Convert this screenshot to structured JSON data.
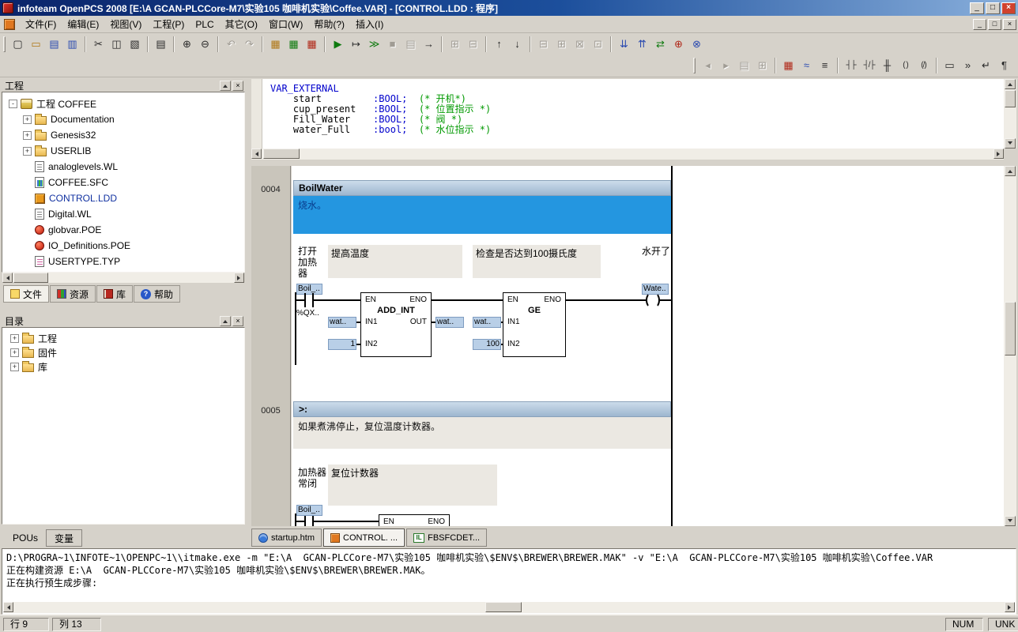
{
  "titlebar": {
    "title": "infoteam OpenPCS 2008 [E:\\A  GCAN-PLCCore-M7\\实验105 咖啡机实验\\Coffee.VAR]  - [CONTROL.LDD : 程序]",
    "minimize": "_",
    "maximize": "□",
    "close": "×"
  },
  "menubar": {
    "items": [
      "文件(F)",
      "编辑(E)",
      "视图(V)",
      "工程(P)",
      "PLC",
      "其它(O)",
      "窗口(W)",
      "帮助(?)",
      "插入(I)"
    ],
    "child_min": "_",
    "child_restore": "□",
    "child_close": "×"
  },
  "toolbar_main": {
    "icons": [
      {
        "name": "new-file-icon",
        "glyph": "▢"
      },
      {
        "name": "open-folder-icon",
        "glyph": "▭"
      },
      {
        "name": "save-icon",
        "glyph": "▤"
      },
      {
        "name": "save-all-icon",
        "glyph": "▥"
      },
      {
        "name": "cut-icon",
        "glyph": "✂"
      },
      {
        "name": "copy-icon",
        "glyph": "◫"
      },
      {
        "name": "paste-icon",
        "glyph": "▧"
      },
      {
        "name": "print-icon",
        "glyph": "▤"
      },
      {
        "name": "zoom-in-icon",
        "glyph": "⊕"
      },
      {
        "name": "zoom-out-icon",
        "glyph": "⊖"
      },
      {
        "name": "undo-icon",
        "glyph": "↶"
      },
      {
        "name": "redo-icon",
        "glyph": "↷"
      },
      {
        "name": "build-icon",
        "glyph": "▦"
      },
      {
        "name": "make-all-icon",
        "glyph": "▦"
      },
      {
        "name": "rebuild-icon",
        "glyph": "▦"
      },
      {
        "name": "run-icon",
        "glyph": "▶"
      },
      {
        "name": "step-icon",
        "glyph": "↦"
      },
      {
        "name": "continue-icon",
        "glyph": "≫"
      },
      {
        "name": "stop-icon",
        "glyph": "■"
      },
      {
        "name": "call-stack-icon",
        "glyph": "▤"
      },
      {
        "name": "goto-icon",
        "glyph": "→"
      },
      {
        "name": "watch-list-icon",
        "glyph": "⊞"
      },
      {
        "name": "cross-reference-icon",
        "glyph": "⊟"
      },
      {
        "name": "move-up-icon",
        "glyph": "↑"
      },
      {
        "name": "move-down-icon",
        "glyph": "↓"
      },
      {
        "name": "window-layout-1-icon",
        "glyph": "⊟"
      },
      {
        "name": "window-layout-2-icon",
        "glyph": "⊞"
      },
      {
        "name": "window-layout-3-icon",
        "glyph": "⊠"
      },
      {
        "name": "window-layout-4-icon",
        "glyph": "⊡"
      },
      {
        "name": "download-icon",
        "glyph": "⇊"
      },
      {
        "name": "upload-icon",
        "glyph": "⇈"
      },
      {
        "name": "compare-icon",
        "glyph": "⇄"
      },
      {
        "name": "online-icon",
        "glyph": "⊕"
      },
      {
        "name": "offline-icon",
        "glyph": "⊗"
      }
    ]
  },
  "toolbar_ladder": {
    "icons": [
      {
        "name": "back-icon",
        "glyph": "◂"
      },
      {
        "name": "forward-icon",
        "glyph": "▸"
      },
      {
        "name": "page-overview-icon",
        "glyph": "▤"
      },
      {
        "name": "watch-window-icon",
        "glyph": "⊞"
      },
      {
        "name": "io-editor-icon",
        "glyph": "▦"
      },
      {
        "name": "trace-icon",
        "glyph": "≈"
      },
      {
        "name": "network-list-icon",
        "glyph": "≡"
      },
      {
        "name": "insert-contact-icon",
        "glyph": "┤├"
      },
      {
        "name": "insert-negated-contact-icon",
        "glyph": "┤/├"
      },
      {
        "name": "insert-parallel-contact-icon",
        "glyph": "╫"
      },
      {
        "name": "insert-coil-icon",
        "glyph": "( )"
      },
      {
        "name": "insert-negated-coil-icon",
        "gl yph": "(/)",
        "glyph": "(/)"
      },
      {
        "name": "insert-function-block-icon",
        "glyph": "▭"
      },
      {
        "name": "insert-jump-icon",
        "glyph": "»"
      },
      {
        "name": "insert-return-icon",
        "glyph": "↵"
      },
      {
        "name": "insert-label-icon",
        "glyph": "¶"
      }
    ]
  },
  "project_panel": {
    "title": "工程",
    "close": "×",
    "root": {
      "label": "工程 COFFEE",
      "expander": "-"
    },
    "items": [
      {
        "label": "Documentation",
        "expander": "+"
      },
      {
        "label": "Genesis32",
        "expander": "+"
      },
      {
        "label": "USERLIB",
        "expander": "+"
      },
      {
        "label": "analoglevels.WL",
        "expander": ""
      },
      {
        "label": "COFFEE.SFC",
        "expander": ""
      },
      {
        "label": "CONTROL.LDD",
        "expander": ""
      },
      {
        "label": "Digital.WL",
        "expander": ""
      },
      {
        "label": "globvar.POE",
        "expander": ""
      },
      {
        "label": "IO_Definitions.POE",
        "expander": ""
      },
      {
        "label": "USERTYPE.TYP",
        "expander": ""
      }
    ],
    "tabs": [
      {
        "label": "文件"
      },
      {
        "label": "资源"
      },
      {
        "label": "库"
      },
      {
        "label": "帮助"
      }
    ]
  },
  "directory_panel": {
    "title": "目录",
    "close": "×",
    "items": [
      {
        "label": "工程",
        "expander": "+"
      },
      {
        "label": "固件",
        "expander": "+"
      },
      {
        "label": "库",
        "expander": "+"
      }
    ]
  },
  "left_tabs": [
    {
      "label": "POUs"
    },
    {
      "label": "变量"
    }
  ],
  "doc_tabs": [
    {
      "label": "startup.htm"
    },
    {
      "label": "CONTROL. ..."
    },
    {
      "label": "FBSFCDET...",
      "badge": "IL"
    }
  ],
  "code_editor": {
    "lines": [
      {
        "kw": "VAR_EXTERNAL",
        "name": "",
        "type": "",
        "comment": ""
      },
      {
        "kw": "",
        "name": "    start         ",
        "type": ":BOOL;",
        "comment": "  (* 开机*)"
      },
      {
        "kw": "",
        "name": "    cup_present   ",
        "type": ":BOOL;",
        "comment": "  (* 位置指示 *)"
      },
      {
        "kw": "",
        "name": "    Fill_Water    ",
        "type": ":BOOL;",
        "comment": "  (* 阀 *)"
      },
      {
        "kw": "",
        "name": "    water_Full    ",
        "type": ":bool;",
        "comment": "  (* 水位指示 *)"
      }
    ]
  },
  "ladder": {
    "rung1": {
      "number": "0004",
      "title": "BoilWater",
      "comment": "烧水。",
      "contact_comment": "打开加热器",
      "comment_a": "提高温度",
      "comment_b": "检查是否达到100摄氏度",
      "coil_comment": "水开了",
      "contact_label": "Boil_..",
      "contact_address": "%QX..",
      "add": {
        "en": "EN",
        "eno": "ENO",
        "name": "ADD_INT",
        "in1": "IN1",
        "in2": "IN2",
        "out": "OUT"
      },
      "ge": {
        "en": "EN",
        "eno": "ENO",
        "name": "GE",
        "in1": "IN1",
        "in2": "IN2"
      },
      "op": {
        "add_in1": "wat..",
        "add_in2": "1",
        "add_out": "wat..",
        "ge_in1": "wat..",
        "ge_in2": "100"
      },
      "coil_label": "Wate.."
    },
    "rung2": {
      "number": "0005",
      "title": ">:",
      "comment": "如果煮沸停止，复位温度计数器。",
      "contact_comment": "加热器常闭",
      "comment_a": "复位计数器",
      "contact_label": "Boil_..",
      "blk": {
        "en": "EN",
        "eno": "ENO"
      }
    }
  },
  "output": {
    "lines": [
      "D:\\PROGRA~1\\INFOTE~1\\OPENPC~1\\\\itmake.exe -m \"E:\\A  GCAN-PLCCore-M7\\实验105 咖啡机实验\\$ENV$\\BREWER\\BREWER.MAK\" -v \"E:\\A  GCAN-PLCCore-M7\\实验105 咖啡机实验\\Coffee.VAR",
      "正在构建资源 E:\\A  GCAN-PLCCore-M7\\实验105 咖啡机实验\\$ENV$\\BREWER\\BREWER.MAK。",
      "正在执行预生成步骤:"
    ]
  },
  "statusbar": {
    "row": "行 9",
    "col": "列 13",
    "num": "NUM",
    "unk": "UNK"
  }
}
